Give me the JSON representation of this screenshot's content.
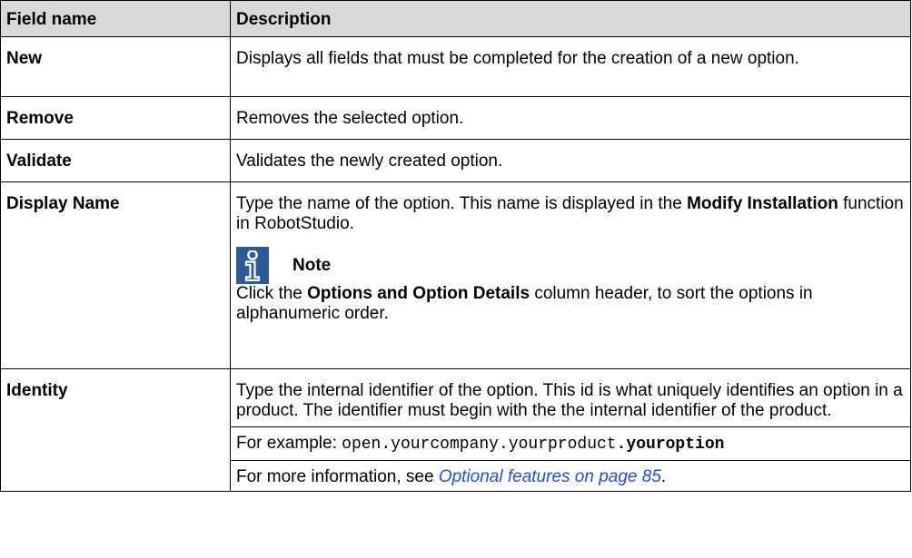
{
  "table": {
    "headers": {
      "field": "Field name",
      "description": "Description"
    },
    "rows": {
      "new": {
        "field": "New",
        "description": "Displays all fields that must be completed for the creation of a new option."
      },
      "remove": {
        "field": "Remove",
        "description": "Removes the selected option."
      },
      "validate": {
        "field": "Validate",
        "description": "Validates the newly created option."
      },
      "display_name": {
        "field": "Display Name",
        "desc_part1": "Type the name of the option. This name is displayed in the ",
        "desc_bold": "Modify Installation",
        "desc_part2": " function in RobotStudio.",
        "note_icon": "info-icon",
        "note_label": "Note",
        "note_part1": "Click the ",
        "note_bold": "Options and Option Details",
        "note_part2": " column header, to sort the options in alphanumeric order."
      },
      "identity": {
        "field": "Identity",
        "description": "Type the internal identifier of the option. This id is what uniquely identifies an option in a product. The identifier must begin with the the internal identifier of the product.",
        "example_label": "For example: ",
        "example_code": "open.yourcompany.yourproduct",
        "example_code_bold": ".youroption",
        "more_info_prefix": "For more information, see ",
        "more_info_link": "Optional features on page 85",
        "more_info_suffix": "."
      }
    }
  },
  "colors": {
    "header_bg": "#d9d9d9",
    "note_icon_bg": "#2f5b95",
    "link": "#1f4fd6"
  }
}
